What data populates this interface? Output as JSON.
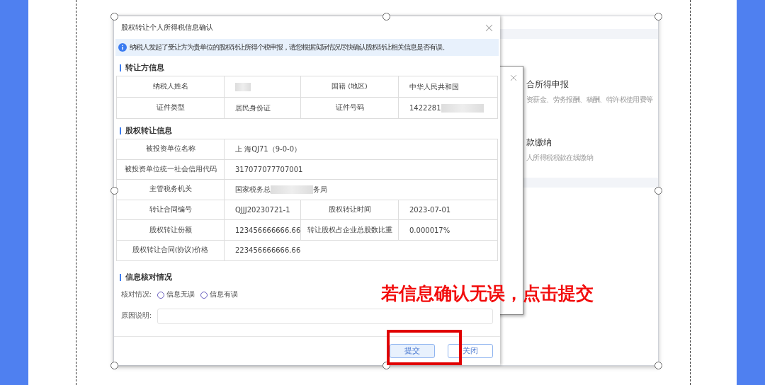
{
  "dialog": {
    "title": "股权转让个人所得税信息确认",
    "notice": "纳税人发起了受让方为贵单位的股权转让所得个税申报，请您根据实际情况尽快确认股权转让相关信息是否有误。",
    "sections": [
      {
        "heading": "转让方信息",
        "rows": [
          [
            {
              "kind": "label",
              "parts": [
                {
                  "kind": "text",
                  "text": "纳税人姓名"
                }
              ]
            },
            {
              "kind": "value",
              "parts": [
                {
                  "kind": "blur"
                }
              ]
            },
            {
              "kind": "label",
              "parts": [
                {
                  "kind": "text",
                  "text": "国籍 (地区)"
                }
              ]
            },
            {
              "kind": "value",
              "parts": [
                {
                  "kind": "text",
                  "text": "中华人民共和国"
                }
              ]
            }
          ],
          [
            {
              "kind": "label",
              "parts": [
                {
                  "kind": "text",
                  "text": "证件类型"
                }
              ]
            },
            {
              "kind": "value",
              "parts": [
                {
                  "kind": "text",
                  "text": "居民身份证"
                }
              ]
            },
            {
              "kind": "label",
              "parts": [
                {
                  "kind": "text",
                  "text": "证件号码"
                }
              ]
            },
            {
              "kind": "value",
              "parts": [
                {
                  "kind": "text",
                  "text": "1422281"
                },
                {
                  "kind": "blur"
                }
              ]
            }
          ]
        ]
      },
      {
        "heading": "股权转让信息",
        "rows": [
          [
            {
              "kind": "label",
              "parts": [
                {
                  "kind": "text",
                  "text": "被投资单位名称"
                }
              ]
            },
            {
              "kind": "value",
              "parts": [
                {
                  "kind": "text",
                  "text": "上 海QJ71（9-0-0）"
                }
              ]
            }
          ],
          [
            {
              "kind": "label",
              "parts": [
                {
                  "kind": "text",
                  "text": "被投资单位统一社会信用代码"
                }
              ]
            },
            {
              "kind": "value",
              "parts": [
                {
                  "kind": "text",
                  "text": "317077077707001"
                }
              ]
            }
          ],
          [
            {
              "kind": "label",
              "parts": [
                {
                  "kind": "text",
                  "text": "主管税务机关"
                }
              ]
            },
            {
              "kind": "value",
              "parts": [
                {
                  "kind": "text",
                  "text": "国家税务总"
                },
                {
                  "kind": "blur"
                },
                {
                  "kind": "text",
                  "text": "务局"
                }
              ]
            }
          ],
          [
            {
              "kind": "label",
              "parts": [
                {
                  "kind": "text",
                  "text": "转让合同编号"
                }
              ]
            },
            {
              "kind": "value",
              "parts": [
                {
                  "kind": "text",
                  "text": "QJJJ20230721-1"
                }
              ]
            },
            {
              "kind": "label",
              "parts": [
                {
                  "kind": "text",
                  "text": "股权转让时间"
                }
              ]
            },
            {
              "kind": "value",
              "parts": [
                {
                  "kind": "text",
                  "text": "2023-07-01"
                }
              ]
            }
          ],
          [
            {
              "kind": "label",
              "parts": [
                {
                  "kind": "text",
                  "text": "股权转让份额"
                }
              ]
            },
            {
              "kind": "value",
              "parts": [
                {
                  "kind": "text",
                  "text": "123456666666.66"
                }
              ]
            },
            {
              "kind": "label",
              "parts": [
                {
                  "kind": "text",
                  "text": "转让股权占企业总股数比重"
                }
              ]
            },
            {
              "kind": "value",
              "parts": [
                {
                  "kind": "text",
                  "text": "0.000017%"
                }
              ]
            }
          ],
          [
            {
              "kind": "label",
              "parts": [
                {
                  "kind": "text",
                  "text": "股权转让合同(协议)价格"
                }
              ]
            },
            {
              "kind": "value",
              "parts": [
                {
                  "kind": "text",
                  "text": "223456666666.66"
                }
              ]
            }
          ]
        ]
      }
    ],
    "check": {
      "heading": "信息核对情况",
      "label": "核对情况:",
      "options": [
        {
          "label": "信息无误",
          "selected": false
        },
        {
          "label": "信息有误",
          "selected": false
        }
      ],
      "reason_label": "原因说明:"
    },
    "buttons": [
      {
        "label": "提交",
        "kind": "primary"
      },
      {
        "label": "关闭",
        "kind": "default"
      }
    ]
  },
  "background_page": {
    "items": [
      {
        "title": "合所得申报",
        "desc": "资薪金、劳务报酬、稿酬、特许权使用费等"
      },
      {
        "title": "款缴纳",
        "desc": "人所得税税款在线缴纳"
      }
    ]
  },
  "annotation": {
    "text": "若信息确认无误，点击提交"
  }
}
